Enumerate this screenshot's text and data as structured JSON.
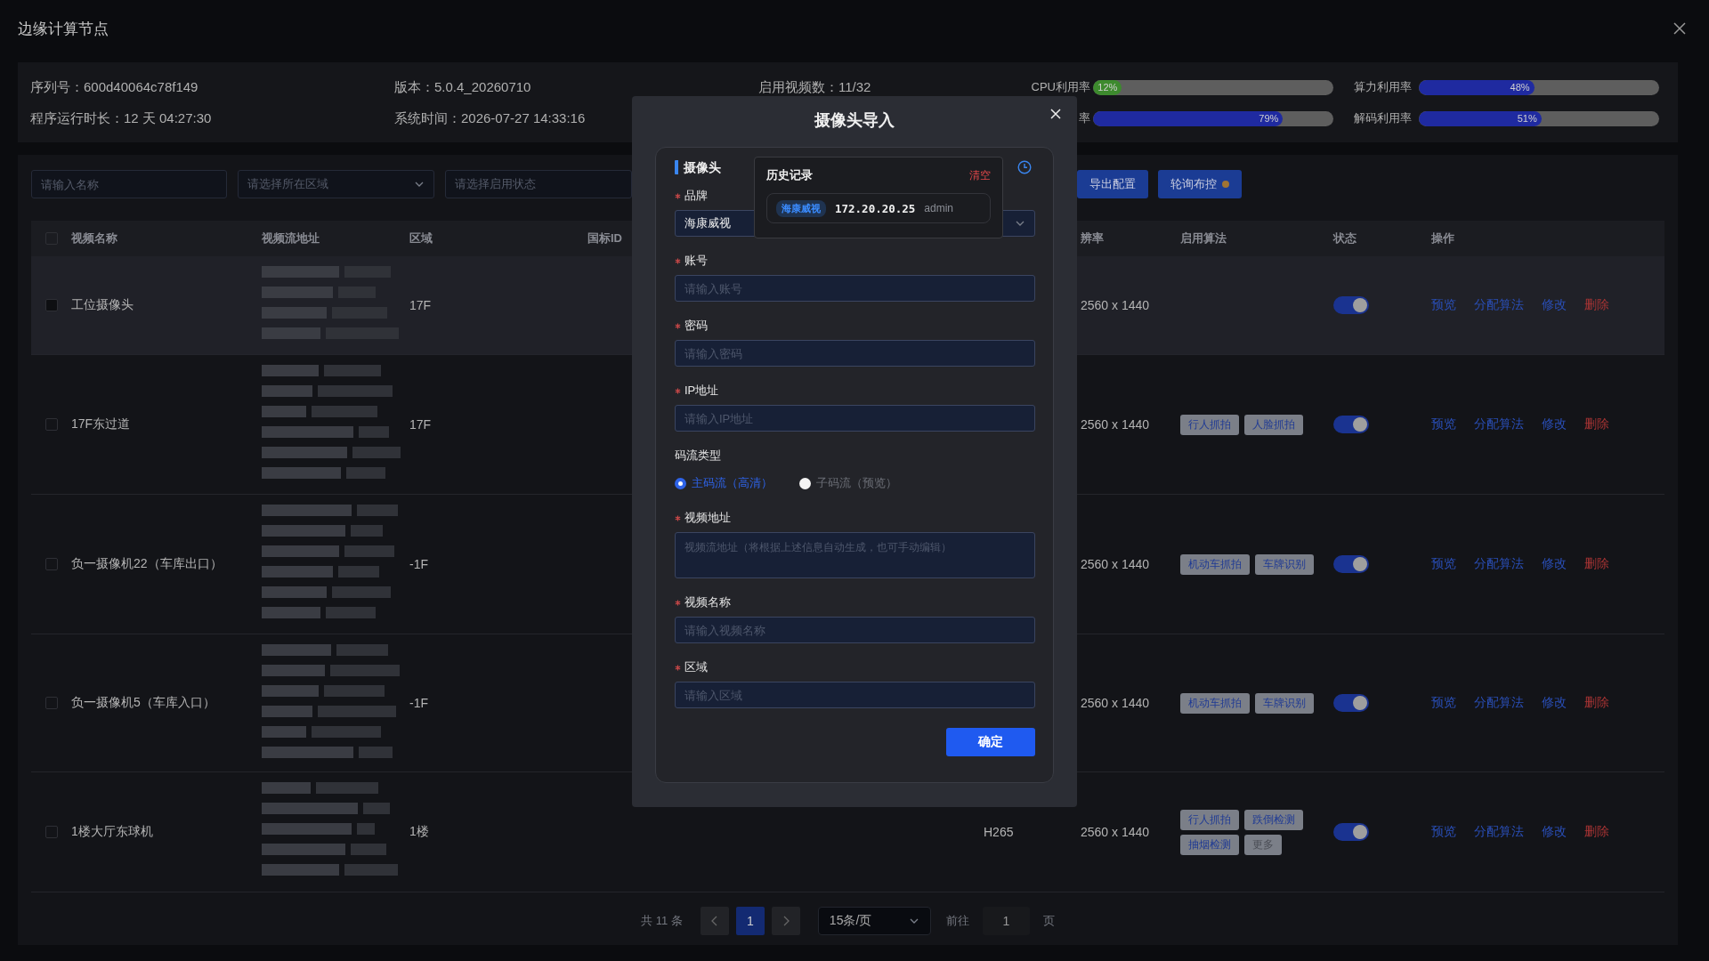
{
  "window": {
    "title": "边缘计算节点"
  },
  "info": [
    {
      "text": "序列号：600d40064c78f149"
    },
    {
      "text": "版本：5.0.4_20260710"
    },
    {
      "text": "启用视频数：11/32"
    },
    {
      "text": "程序运行时长：12 天 04:27:30"
    },
    {
      "text": "系统时间：2026-07-27 14:33:16"
    }
  ],
  "metrics": [
    {
      "label": "CPU利用率",
      "level": 0.12,
      "reading": "12%",
      "color": "#3d8a2e"
    },
    {
      "label": "算力利用率",
      "level": 0.48,
      "reading": "48%",
      "color": "#1f2aa0"
    },
    {
      "label": "率",
      "level": 0.79,
      "reading": "79%",
      "color": "#1f2aa0"
    },
    {
      "label": "解码利用率",
      "level": 0.51,
      "reading": "51%",
      "color": "#1f2aa0"
    }
  ],
  "filters": [
    {
      "kind": "input",
      "placeholder": "请输入名称"
    },
    {
      "kind": "dropdown",
      "placeholder": "请选择所在区域"
    },
    {
      "kind": "truncated",
      "placeholder": "请选择启用状态"
    }
  ],
  "toolbar_buttons": [
    {
      "label": "导出配置",
      "kind": "primary"
    },
    {
      "label": "轮询布控",
      "kind": "indicator"
    }
  ],
  "table": {
    "select_all_checked": false,
    "columns": [
      {
        "kind": "name",
        "label": "视频名称"
      },
      {
        "kind": "url",
        "label": "视频流地址"
      },
      {
        "kind": "area",
        "label": "区域"
      },
      {
        "kind": "gbid",
        "label": "国标ID"
      },
      {
        "kind": "resolution",
        "label": "辨率"
      },
      {
        "kind": "algorithms",
        "label": "启用算法"
      },
      {
        "kind": "status",
        "label": "状态"
      },
      {
        "kind": "ops",
        "label": "操作"
      }
    ],
    "rows": [
      {
        "checked": false,
        "name": "工位摄像头",
        "area": "17F",
        "resolution": "2560 x 1440",
        "enabled": true,
        "hovered": true,
        "actions": [
          {
            "label": "预览",
            "kind": "link"
          },
          {
            "label": "分配算法",
            "kind": "link"
          },
          {
            "label": "修改",
            "kind": "link"
          },
          {
            "label": "删除",
            "kind": "danger"
          }
        ]
      },
      {
        "checked": false,
        "name": "17F东过道",
        "area": "17F",
        "resolution": "2560 x 1440",
        "algorithms": [
          {
            "label": "行人抓拍",
            "kind": "tag"
          },
          {
            "label": "人脸抓拍",
            "kind": "tag"
          }
        ],
        "enabled": true,
        "hovered": false,
        "actions": [
          {
            "label": "预览",
            "kind": "link"
          },
          {
            "label": "分配算法",
            "kind": "link"
          },
          {
            "label": "修改",
            "kind": "link"
          },
          {
            "label": "删除",
            "kind": "danger"
          }
        ]
      },
      {
        "checked": false,
        "name": "负一摄像机22（车库出口）",
        "area": "-1F",
        "resolution": "2560 x 1440",
        "algorithms": [
          {
            "label": "机动车抓拍",
            "kind": "tag"
          },
          {
            "label": "车牌识别",
            "kind": "tag"
          }
        ],
        "enabled": true,
        "hovered": false,
        "actions": [
          {
            "label": "预览",
            "kind": "link"
          },
          {
            "label": "分配算法",
            "kind": "link"
          },
          {
            "label": "修改",
            "kind": "link"
          },
          {
            "label": "删除",
            "kind": "danger"
          }
        ]
      },
      {
        "checked": false,
        "name": "负一摄像机5（车库入口）",
        "area": "-1F",
        "resolution": "2560 x 1440",
        "algorithms": [
          {
            "label": "机动车抓拍",
            "kind": "tag"
          },
          {
            "label": "车牌识别",
            "kind": "tag"
          }
        ],
        "enabled": true,
        "hovered": false,
        "actions": [
          {
            "label": "预览",
            "kind": "link"
          },
          {
            "label": "分配算法",
            "kind": "link"
          },
          {
            "label": "修改",
            "kind": "link"
          },
          {
            "label": "删除",
            "kind": "danger"
          }
        ]
      },
      {
        "checked": false,
        "name": "1楼大厅东球机",
        "area": "1楼",
        "codec": "H265",
        "resolution": "2560 x 1440",
        "algorithms": [
          {
            "label": "行人抓拍",
            "kind": "tag"
          },
          {
            "label": "跌倒检测",
            "kind": "tag"
          },
          {
            "label": "抽烟检测",
            "kind": "tag"
          },
          {
            "label": "更多",
            "kind": "more"
          }
        ],
        "enabled": true,
        "hovered": false,
        "actions": [
          {
            "label": "预览",
            "kind": "link"
          },
          {
            "label": "分配算法",
            "kind": "link"
          },
          {
            "label": "修改",
            "kind": "link"
          },
          {
            "label": "删除",
            "kind": "danger"
          }
        ]
      }
    ]
  },
  "pager": {
    "total": "共 11 条",
    "pages": [
      {
        "label": "1",
        "selected": true
      }
    ],
    "page_size": "15条/页",
    "goto_label": "前往",
    "goto_value": "1",
    "page_unit": "页"
  },
  "dialog": {
    "title": "摄像头导入",
    "section": "摄像头",
    "fields": [
      {
        "kind": "select",
        "label": "品牌",
        "required": true,
        "value": "海康威视"
      },
      {
        "kind": "input",
        "label": "账号",
        "required": true,
        "placeholder": "请输入账号"
      },
      {
        "kind": "input",
        "label": "密码",
        "required": true,
        "placeholder": "请输入密码"
      },
      {
        "kind": "input",
        "label": "IP地址",
        "required": true,
        "placeholder": "请输入IP地址"
      },
      {
        "kind": "radio",
        "label": "码流类型",
        "required": false,
        "options": [
          {
            "label": "主码流（高清）",
            "selected": true
          },
          {
            "label": "子码流（预览）",
            "selected": false
          }
        ]
      },
      {
        "kind": "textarea",
        "label": "视频地址",
        "required": true,
        "placeholder": "视频流地址（将根据上述信息自动生成，也可手动编辑）"
      },
      {
        "kind": "input",
        "label": "视频名称",
        "required": true,
        "placeholder": "请输入视频名称"
      },
      {
        "kind": "input",
        "label": "区域",
        "required": true,
        "placeholder": "请输入区域"
      }
    ],
    "submit": "确定",
    "history": {
      "title": "历史记录",
      "clear": "清空",
      "entries": [
        {
          "brand": "海康威视",
          "ip": "172.20.20.25",
          "account": "admin"
        }
      ]
    }
  }
}
